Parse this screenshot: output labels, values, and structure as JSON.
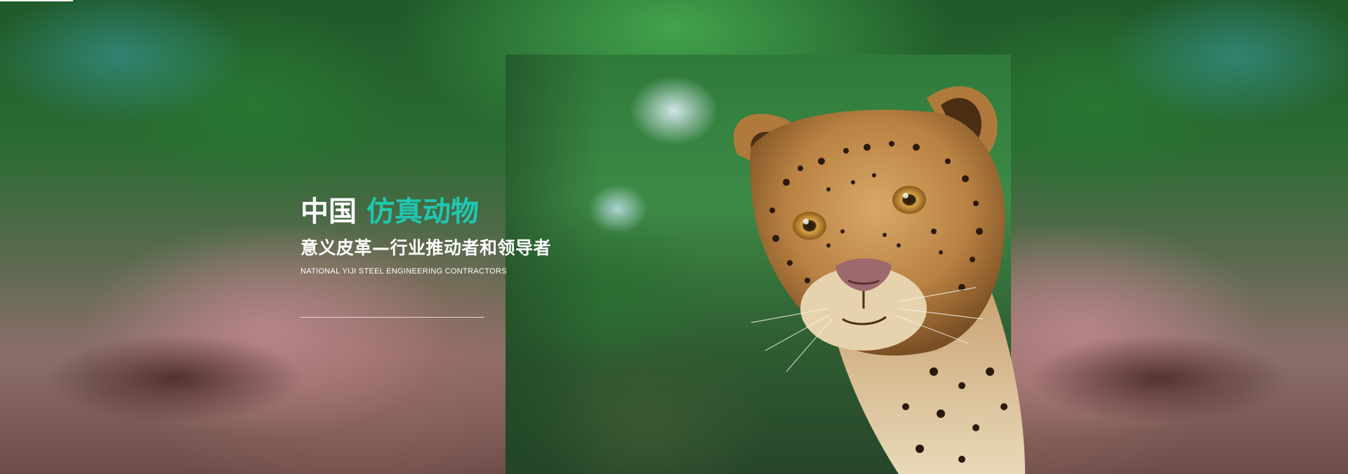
{
  "banner": {
    "title_main": "中国",
    "title_accent": "仿真动物",
    "subtitle": "意义皮革—行业推动者和领导者",
    "english": "NATIONAL YIJI STEEL ENGINEERING CONTRACTORS"
  },
  "colors": {
    "accent": "#1fc7b1",
    "text": "#ffffff"
  }
}
